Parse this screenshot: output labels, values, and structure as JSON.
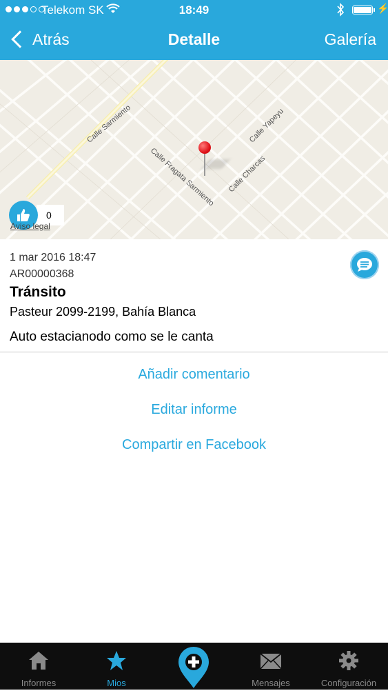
{
  "status_bar": {
    "carrier": "Telekom SK",
    "time": "18:49"
  },
  "nav": {
    "back_label": "Atrás",
    "title": "Detalle",
    "right_label": "Galería"
  },
  "map": {
    "streets": [
      "Calle Sarmiento",
      "Calle Fragata Sarmiento",
      "Calle Charcas",
      "Calle Yapeyu"
    ],
    "like_count": "0",
    "legal_link": "Aviso legal"
  },
  "report": {
    "date": "1 mar 2016 18:47",
    "id": "AR00000368",
    "category": "Tránsito",
    "address": "Pasteur 2099-2199, Bahía Blanca",
    "description": "Auto estacianodo como se le canta"
  },
  "actions": {
    "add_comment": "Añadir comentario",
    "edit_report": "Editar informe",
    "share_facebook": "Compartir en Facebook"
  },
  "tabbar": {
    "tabs": [
      {
        "label": "Informes",
        "icon": "home-icon"
      },
      {
        "label": "Mios",
        "icon": "star-icon"
      },
      {
        "label": "",
        "icon": "add-pin-icon"
      },
      {
        "label": "Mensajes",
        "icon": "envelope-icon"
      },
      {
        "label": "Configuración",
        "icon": "gear-icon"
      }
    ]
  },
  "colors": {
    "accent": "#29a8dc",
    "link": "#2aa9de",
    "tabbar_bg": "#0e0e0e",
    "pin": "#e0141b",
    "map_bg": "#f0ede5"
  }
}
